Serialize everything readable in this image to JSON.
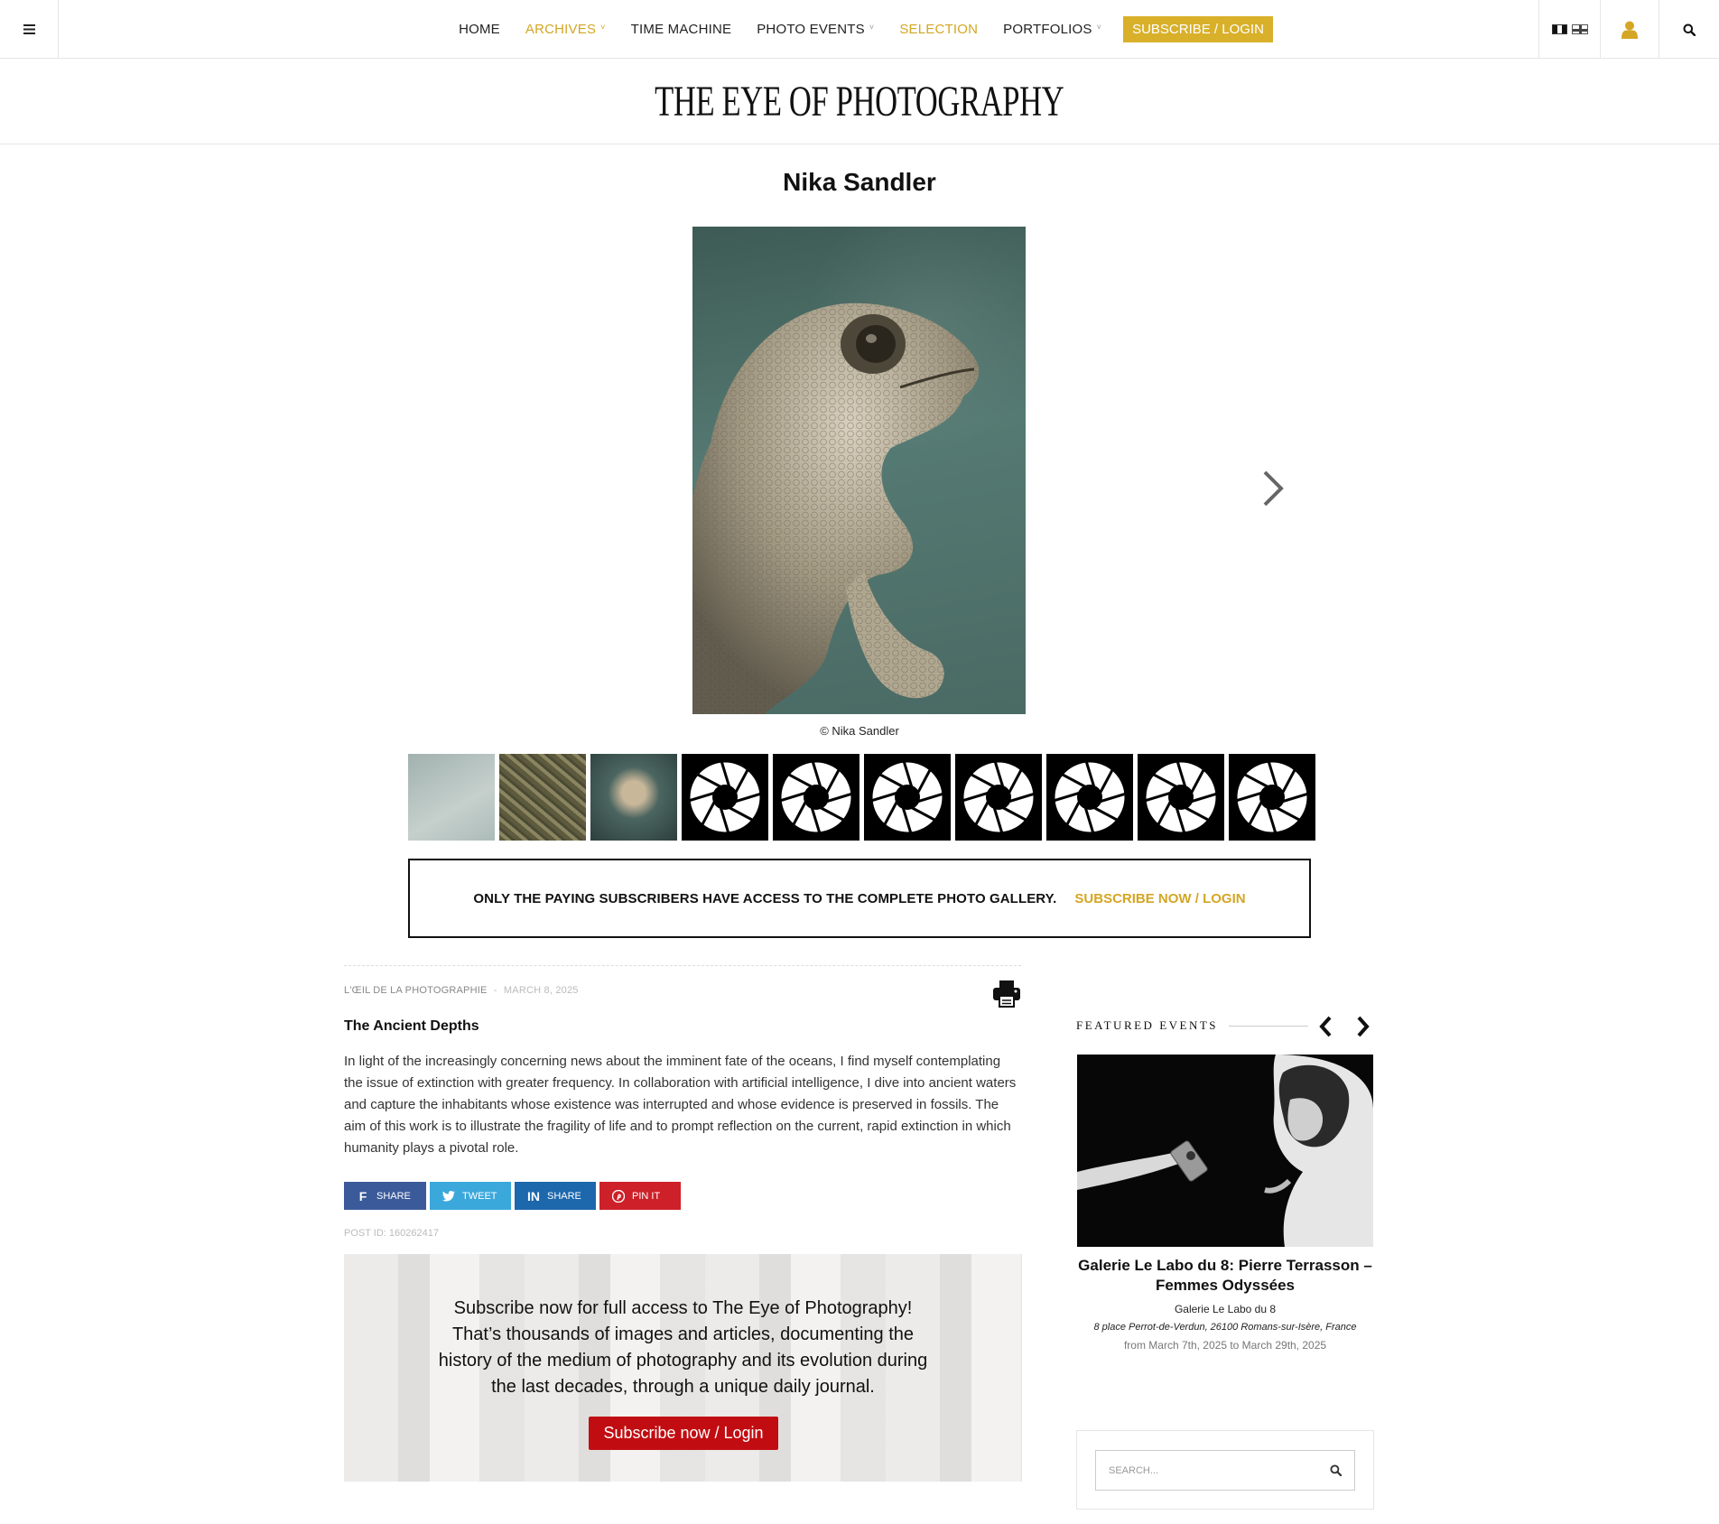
{
  "nav": {
    "items": [
      {
        "label": "HOME",
        "dropdown": false,
        "active": false
      },
      {
        "label": "ARCHIVES",
        "dropdown": true,
        "active": true
      },
      {
        "label": "TIME MACHINE",
        "dropdown": false,
        "active": false
      },
      {
        "label": "PHOTO EVENTS",
        "dropdown": true,
        "active": false
      },
      {
        "label": "SELECTION",
        "dropdown": false,
        "active": true
      },
      {
        "label": "PORTFOLIOS",
        "dropdown": true,
        "active": false
      }
    ],
    "cta_label": "SUBSCRIBE / LOGIN"
  },
  "icons": {
    "menu": "hamburger-icon",
    "flags": [
      "flag-fr-icon",
      "flag-uk-icon"
    ],
    "user": "user-icon",
    "search": "search-icon",
    "print": "printer-icon",
    "next": "chevron-right-icon"
  },
  "site": {
    "logo": "THE EYE OF PHOTOGRAPHY"
  },
  "page": {
    "title": "Nika Sandler",
    "photo_caption": "© Nika Sandler"
  },
  "gallery": {
    "thumbnail_count": 11,
    "locked_thumbnail_count": 8,
    "paywall_text": "ONLY THE PAYING SUBSCRIBERS HAVE ACCESS TO THE COMPLETE PHOTO GALLERY.",
    "paywall_link": "SUBSCRIBE NOW / LOGIN"
  },
  "article": {
    "author": "L'ŒIL DE LA PHOTOGRAPHIE",
    "separator": "-",
    "date": "MARCH 8, 2025",
    "title": "The Ancient Depths",
    "body": "In light of the increasingly concerning news about the imminent fate of the oceans, I find myself contemplating the issue of extinction with greater frequency. In collaboration with artificial intelligence, I dive into ancient waters and capture the inhabitants whose existence was interrupted and whose evidence is preserved in fossils. The aim of this work is to illustrate the fragility of life and to prompt reflection on the current, rapid extinction in which humanity plays a pivotal role.",
    "share_buttons": [
      {
        "label": "SHARE",
        "icon": "facebook-icon",
        "color": "#3b5a9a"
      },
      {
        "label": "TWEET",
        "icon": "twitter-icon",
        "color": "#3ba8dc"
      },
      {
        "label": "SHARE",
        "icon": "linkedin-icon",
        "color": "#1d67ad"
      },
      {
        "label": "PIN IT",
        "icon": "pinterest-icon",
        "color": "#cd2029"
      }
    ],
    "post_id": "POST ID: 160262417"
  },
  "subscribe": {
    "text": "Subscribe now for full access to The Eye of Photography! That’s thousands of images and articles, documenting the history of the medium of photography and its evolution during the last decades, through a unique daily journal.",
    "button": "Subscribe now / Login"
  },
  "sidebar": {
    "featured_title": "FEATURED EVENTS",
    "event": {
      "name": "Galerie Le Labo du 8: Pierre Terrasson – Femmes Odyssées",
      "venue": "Galerie Le Labo du 8",
      "address": "8 place Perrot-de-Verdun, 26100 Romans-sur-Isère, France",
      "dates": "from March 7th, 2025 to March 29th, 2025"
    },
    "search_placeholder": "SEARCH..."
  },
  "colors": {
    "gold": "#d4a624",
    "cta": "#d9b02a",
    "subscribe_red": "#c10d12"
  }
}
